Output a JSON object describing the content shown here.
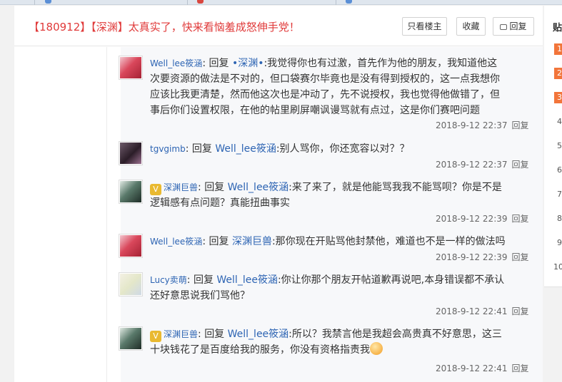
{
  "thread": {
    "title": "【180912】【深渊】太真实了，快来看恼羞成怒伸手党！",
    "buttons": {
      "only_owner": "只看楼主",
      "favorite": "收藏",
      "reply": "回复"
    }
  },
  "sidebar": {
    "title": "贴",
    "ranks": [
      "1",
      "2",
      "3",
      "4",
      "5",
      "6",
      "7",
      "8",
      "9",
      "10"
    ]
  },
  "replies": [
    {
      "user": "Well_lee筱涵",
      "sep": ":",
      "reply_word": "回复",
      "target": "•深渊•",
      "text": ":我觉得你也有过激，首先作为他的朋友，我知道他这次要资源的做法是不对的，但口袋赛尔毕竟也是没有得到授权的，这一点我想你应该比我更清楚，然而他这次也是冲动了，先不说授权，我也觉得他做错了，但事后你们设置权限，在他的帖里刷屏嘲讽谩骂就有点过，这是你们赛吧问题",
      "time": "2018-9-12 22:37",
      "reply_link": "回复"
    },
    {
      "user": "tgvgimb",
      "sep": ":",
      "reply_word": "回复",
      "target": "Well_lee筱涵",
      "text": ":别人骂你，你还宽容以对？？",
      "time": "2018-9-12 22:37",
      "reply_link": "回复"
    },
    {
      "user": "深渊巨兽",
      "sep": ":",
      "reply_word": "回复",
      "target": "Well_lee筱涵",
      "text": ":来了来了，就是他能骂我我不能骂呗？你是不是逻辑感有点问题？真能扭曲事实",
      "time": "2018-9-12 22:39",
      "reply_link": "回复"
    },
    {
      "user": "Well_lee筱涵",
      "sep": ":",
      "reply_word": "回复",
      "target": "深渊巨兽",
      "text": ":那你现在开贴骂他封禁他，难道也不是一样的做法吗",
      "time": "2018-9-12 22:39",
      "reply_link": "回复"
    },
    {
      "user": "Lucy卖萌",
      "sep": ":",
      "reply_word": "回复",
      "target": "Well_lee筱涵",
      "text": ":你让你那个朋友开帖道歉再说吧,本身错误都不承认还好意思说我们骂他？",
      "time": "2018-9-12 22:41",
      "reply_link": "回复"
    },
    {
      "user": "深渊巨兽",
      "sep": ":",
      "reply_word": "回复",
      "target": "Well_lee筱涵",
      "text": ":所以？我禁言他是我超会高贵真不好意思，这三十块钱花了是百度给我的服务，你没有资格指责我",
      "time": "2018-9-12 22:41",
      "reply_link": "回复"
    }
  ]
}
